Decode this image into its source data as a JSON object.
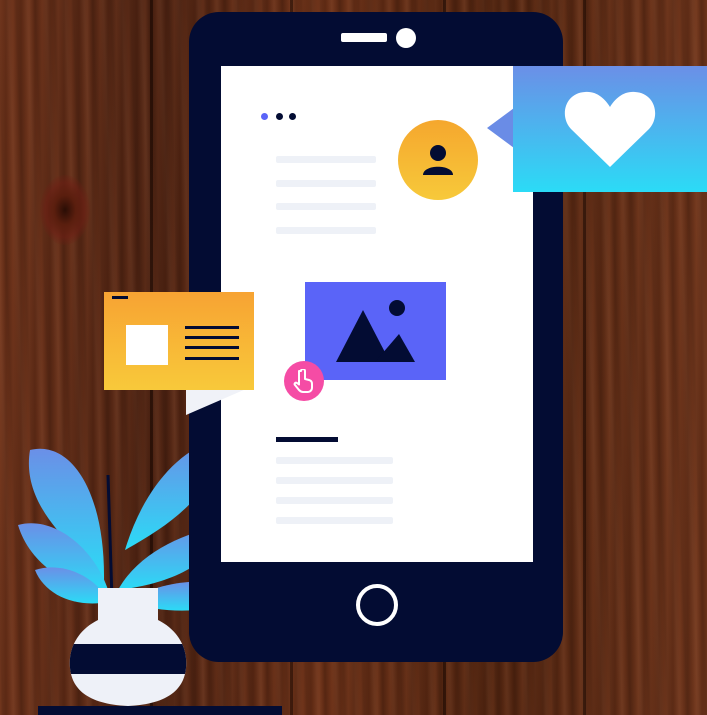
{
  "illustration": {
    "colors": {
      "phone_body": "#030c33",
      "screen": "#ffffff",
      "avatar_gradient": [
        "#f5a72e",
        "#f7c93a"
      ],
      "heart_card_gradient": [
        "#6b8fe7",
        "#2bdbf6"
      ],
      "image_card": "#5a64f8",
      "touch_button": "#f54ca5",
      "doc_card_gradient": [
        "#f7a333",
        "#f8c93a"
      ],
      "plant_leaves": [
        "#6b8fe7",
        "#2bdbf6"
      ],
      "vase_stripe": "#030c33"
    },
    "icons": {
      "avatar": "user-icon",
      "heart": "heart-icon",
      "image": "image-icon",
      "touch": "tap-hand-icon",
      "doc_thumbnail": "image-thumbnail-icon",
      "home": "home-button-icon"
    },
    "menu_dots": [
      "#5a64f8",
      "#030c33",
      "#030c33"
    ]
  }
}
